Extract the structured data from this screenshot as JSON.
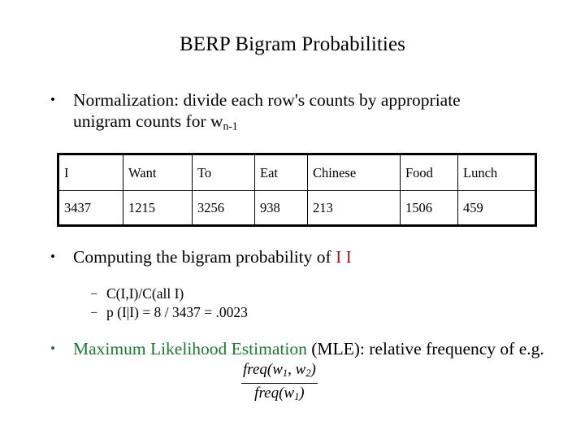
{
  "slide": {
    "title": "BERP Bigram Probabilities",
    "bullets": [
      {
        "marker": "•",
        "text_before": "Normalization:  divide each row's counts by appropriate unigram counts for w",
        "subscript": "n-1",
        "text_after": ""
      },
      {
        "marker": "•",
        "text_before": "Computing the bigram probability of ",
        "highlight": "I I",
        "highlight_color": "#9e1b1b",
        "text_after": ""
      },
      {
        "marker": "•",
        "highlight": "Maximum Likelihood Estimation",
        "highlight_color": "#1a7a2e",
        "text_after": " (MLE): relative frequency of e.g. "
      }
    ],
    "sub_bullets": [
      {
        "marker": "–",
        "text": "C(I,I)/C(all I)"
      },
      {
        "marker": "–",
        "text": "p (I|I) = 8 / 3437 = .0023"
      }
    ],
    "table": {
      "headers": [
        "I",
        "Want",
        "To",
        "Eat",
        "Chinese",
        "Food",
        "Lunch"
      ],
      "values": [
        "3437",
        "1215",
        "3256",
        "938",
        "213",
        "1506",
        "459"
      ]
    },
    "formula": {
      "numerator_fn": "freq(",
      "numerator_args": "w",
      "numerator_sub1": "1",
      "numerator_comma": ", w",
      "numerator_sub2": "2",
      "numerator_close": ")",
      "denominator_fn": "freq(",
      "denominator_args": "w",
      "denominator_sub1": "1",
      "denominator_close": ")"
    }
  }
}
